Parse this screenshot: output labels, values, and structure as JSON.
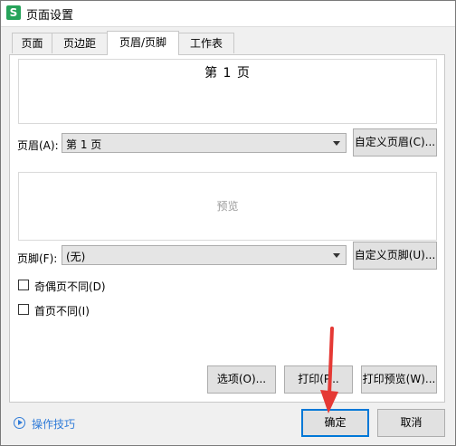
{
  "window": {
    "title": "页面设置",
    "app_icon_glyph": "S"
  },
  "tabs": [
    {
      "label": "页面",
      "active": false
    },
    {
      "label": "页边距",
      "active": false
    },
    {
      "label": "页眉/页脚",
      "active": true
    },
    {
      "label": "工作表",
      "active": false
    }
  ],
  "header": {
    "preview_text": "第 1 页",
    "label": "页眉(A):",
    "selected_value": "第 1 页",
    "custom_button": "自定义页眉(C)..."
  },
  "footer": {
    "preview_text": "预览",
    "label": "页脚(F):",
    "selected_value": "(无)",
    "custom_button": "自定义页脚(U)..."
  },
  "options": {
    "odd_even_label": "奇偶页不同(D)",
    "odd_even_checked": false,
    "first_page_label": "首页不同(I)",
    "first_page_checked": false
  },
  "buttons": {
    "options": "选项(O)...",
    "print": "打印(P...",
    "print_preview": "打印预览(W)...",
    "ok": "确定",
    "cancel": "取消"
  },
  "help": {
    "label": "操作技巧"
  },
  "colors": {
    "accent": "#0078d7",
    "link": "#2f7bd8",
    "annotation_arrow": "#e53935",
    "app_icon": "#26a35a"
  },
  "icons": {
    "app": "wps-spreadsheet-icon",
    "help": "play-circle-icon",
    "dropdown": "chevron-down-icon"
  }
}
